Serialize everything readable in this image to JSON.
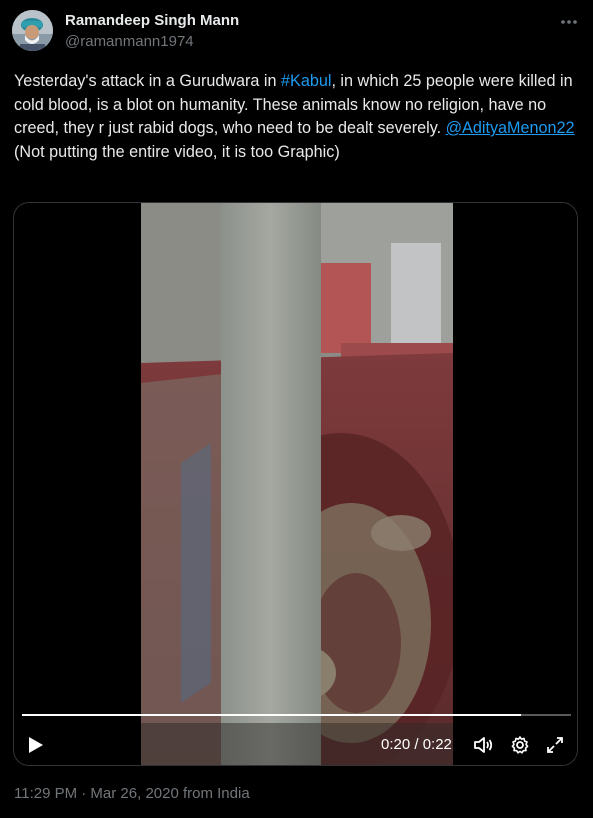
{
  "author": {
    "name": "Ramandeep Singh Mann",
    "handle": "@ramanmann1974"
  },
  "tweet": {
    "text_1": "Yesterday's attack in a Gurudwara in ",
    "hashtag": "#Kabul",
    "text_2": ", in which 25 people were killed in cold blood, is a blot on humanity. These animals know no religion, have no creed, they r just rabid dogs, who need to be dealt severely. ",
    "mention": "@AdityaMenon22",
    "text_3": "\n(Not putting the entire video, it is too Graphic)"
  },
  "video": {
    "time_display": "0:20 / 0:22",
    "progress": 0.909
  },
  "meta": {
    "timestamp": "11:29 PM · Mar 26, 2020 from India"
  },
  "colors": {
    "background": "#000000",
    "text": "#e7e9ea",
    "muted": "#71767b",
    "link": "#1d9bf0"
  },
  "icons": [
    "more-icon",
    "play-icon",
    "volume-icon",
    "settings-icon",
    "fullscreen-icon"
  ]
}
